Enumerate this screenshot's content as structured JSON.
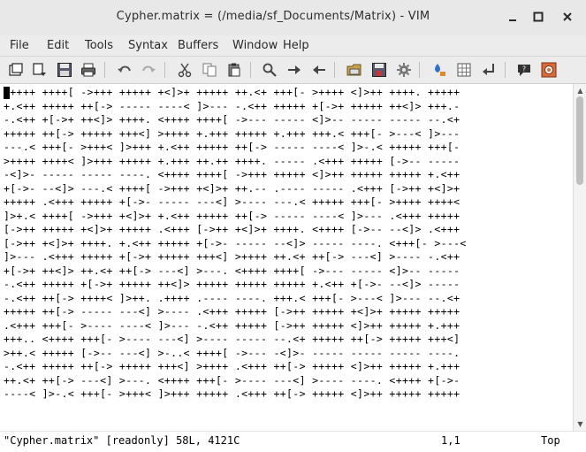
{
  "window": {
    "title": "Cypher.matrix = (/media/sf_Documents/Matrix) - VIM",
    "controls": {
      "minimize": "–",
      "maximize": "□",
      "close": "✕"
    }
  },
  "menubar": {
    "items": [
      "File",
      "Edit",
      "Tools",
      "Syntax",
      "Buffers",
      "Window",
      "Help"
    ]
  },
  "toolbar": {
    "icons": [
      "open-icon",
      "save-session-icon",
      "save-icon",
      "print-icon",
      "undo-icon",
      "redo-icon",
      "cut-icon",
      "copy-icon",
      "paste-icon",
      "find-icon",
      "find-next-icon",
      "find-prev-icon",
      "load-session-icon",
      "save-session-2-icon",
      "run-script-icon",
      "make-icon",
      "ctags-icon",
      "jump-tag-icon",
      "help-icon",
      "find-help-icon"
    ]
  },
  "editor": {
    "lines": [
      "+++++ ++++[ ->+++ +++++ +<]>+ +++++ ++.<+ +++[- >++++ <]>++ ++++. +++++",
      "+.<++ +++++ ++[-> ----- ----< ]>--- -.<++ +++++ +[->+ +++++ ++<]> +++.-",
      "-.<++ +[->+ ++<]> ++++. <++++ ++++[ ->--- ----- <]>-- ----- ----- --.<+",
      "+++++ ++[-> +++++ +++<] >++++ +.+++ +++++ +.+++ +++.< +++[- >---< ]>---",
      "---.< +++[- >+++< ]>+++ +.<++ +++++ ++[-> ----- ----< ]>-.< +++++ +++[-",
      ">++++ ++++< ]>+++ +++++ +.+++ ++.++ ++++. ----- .<+++ +++++ [->-- -----",
      "-<]>- ----- ----- ----. <++++ ++++[ ->+++ +++++ <]>++ +++++ +++++ +.<++",
      "+[->- --<]> ---.< ++++[ ->+++ +<]>+ ++.-- .---- ----- .<+++ [->++ +<]>+",
      "+++++ .<+++ +++++ +[->- ----- ---<] >---- ---.< +++++ +++[- >++++ ++++<",
      "]>+.< ++++[ ->+++ +<]>+ +.<++ +++++ ++[-> ----- ----< ]>--- .<+++ +++++",
      "[->++ +++++ +<]>+ +++++ .<+++ [->++ +<]>+ ++++. <++++ [->-- --<]> .<+++",
      "[->++ +<]>+ ++++. +.<++ +++++ +[->- ----- --<]> ----- ----. <+++[- >---<",
      "]>--- .<+++ +++++ +[->+ +++++ +++<] >++++ ++.<+ ++[-> ---<] >---- -.<++",
      "+[->+ ++<]> ++.<+ ++[-> ---<] >---. <++++ ++++[ ->--- ----- <]>-- -----",
      "-.<++ +++++ +[->+ +++++ ++<]> +++++ +++++ +++++ +.<++ +[->- --<]> -----",
      "-.<++ ++[-> ++++< ]>++. .++++ .---- ----. +++.< +++[- >---< ]>--- --.<+",
      "+++++ ++[-> ----- ---<] >---- .<+++ +++++ [->++ +++++ +<]>+ +++++ +++++",
      ".<+++ +++[- >---- ----< ]>--- -.<++ +++++ [->++ +++++ <]>++ +++++ +.+++",
      "+++.. <++++ +++[- >---- ---<] >---- ----- --.<+ +++++ ++[-> +++++ +++<]",
      ">++.< +++++ [->-- ---<] >-..< ++++[ ->--- -<]>- ----- ----- ----- ----.",
      "-.<++ +++++ ++[-> +++++ +++<] >++++ .<+++ ++[-> +++++ <]>++ +++++ +.+++",
      "++.<+ ++[-> ---<] >---. <++++ +++[- >---- ---<] >---- ----. <++++ +[->-",
      "----< ]>-.< +++[- >+++< ]>+++ +++++ .<+++ ++[-> +++++ <]>++ +++++ +++++"
    ]
  },
  "statusline": {
    "message": "\"Cypher.matrix\" [readonly] 58L, 4121C",
    "position": "1,1",
    "scroll": "Top"
  }
}
